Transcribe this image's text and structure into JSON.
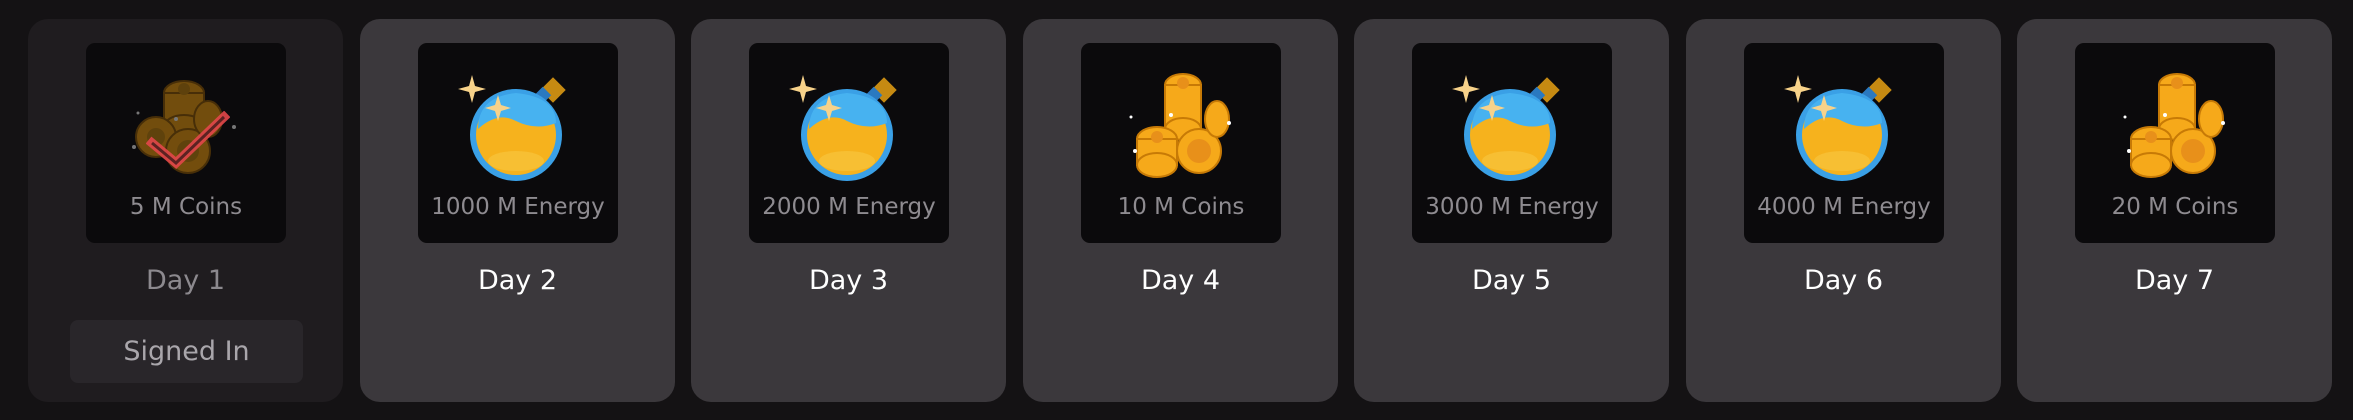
{
  "days": [
    {
      "day": "Day 1",
      "reward": "5 M Coins",
      "icon": "coins-icon",
      "status": "claimed",
      "action": "Signed In"
    },
    {
      "day": "Day 2",
      "reward": "1000 M Energy",
      "icon": "energy-potion-icon",
      "status": "locked"
    },
    {
      "day": "Day 3",
      "reward": "2000 M Energy",
      "icon": "energy-potion-icon",
      "status": "locked"
    },
    {
      "day": "Day 4",
      "reward": "10 M Coins",
      "icon": "coins-icon",
      "status": "locked"
    },
    {
      "day": "Day 5",
      "reward": "3000 M Energy",
      "icon": "energy-potion-icon",
      "status": "locked"
    },
    {
      "day": "Day 6",
      "reward": "4000 M Energy",
      "icon": "energy-potion-icon",
      "status": "locked"
    },
    {
      "day": "Day 7",
      "reward": "20 M Coins",
      "icon": "coins-icon",
      "status": "locked"
    }
  ],
  "colors": {
    "background": "#141214",
    "card": "#3b383c",
    "card_claimed": "#1f1c1f",
    "reward_box": "#0b0a0c",
    "check": "#e2474a",
    "potion_blue": "#3aa0e6",
    "gold": "#f6b21d"
  }
}
